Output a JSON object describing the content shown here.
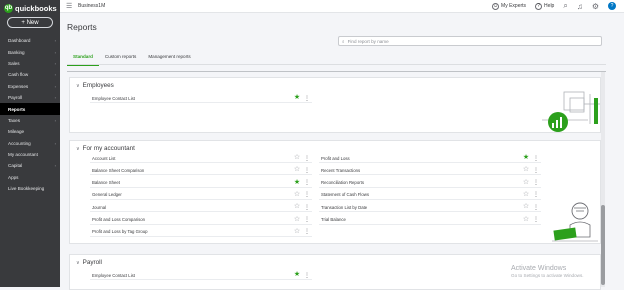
{
  "app": {
    "logo_text": "quickbooks",
    "new_label": "+ New"
  },
  "sidebar": {
    "items": [
      {
        "label": "Dashboard",
        "chev": true
      },
      {
        "label": "Banking",
        "chev": true
      },
      {
        "label": "Sales",
        "chev": true
      },
      {
        "label": "Cash flow",
        "chev": true
      },
      {
        "label": "Expenses",
        "chev": true
      },
      {
        "label": "Payroll",
        "chev": true
      },
      {
        "label": "Reports",
        "chev": false,
        "active": true
      },
      {
        "label": "Taxes",
        "chev": true
      },
      {
        "label": "Mileage",
        "chev": false
      },
      {
        "label": "Accounting",
        "chev": true
      },
      {
        "label": "My accountant",
        "chev": false
      },
      {
        "label": "Capital",
        "chev": true
      },
      {
        "label": "Apps",
        "chev": false
      },
      {
        "label": "Live Bookkeeping",
        "chev": false
      }
    ]
  },
  "topbar": {
    "company": "Business1M",
    "my_experts": "My Experts",
    "help": "Help"
  },
  "page": {
    "title": "Reports",
    "search_placeholder": "Find report by name"
  },
  "tabs": [
    "Standard",
    "Custom reports",
    "Management reports"
  ],
  "sections": {
    "employees": {
      "title": "Employees",
      "reports": [
        {
          "name": "Employee Contact List",
          "fav": true
        }
      ]
    },
    "accountant": {
      "title": "For my accountant",
      "left": [
        {
          "name": "Account List",
          "fav": false
        },
        {
          "name": "Balance Sheet Comparison",
          "fav": false
        },
        {
          "name": "Balance Sheet",
          "fav": true
        },
        {
          "name": "General Ledger",
          "fav": false
        },
        {
          "name": "Journal",
          "fav": false
        },
        {
          "name": "Profit and Loss Comparison",
          "fav": false
        },
        {
          "name": "Profit and Loss by Tag Group",
          "fav": false
        }
      ],
      "right": [
        {
          "name": "Profit and Loss",
          "fav": true
        },
        {
          "name": "Recent Transactions",
          "fav": false
        },
        {
          "name": "Reconciliation Reports",
          "fav": false
        },
        {
          "name": "Statement of Cash Flows",
          "fav": false
        },
        {
          "name": "Transaction List by Date",
          "fav": false
        },
        {
          "name": "Trial Balance",
          "fav": false
        }
      ]
    },
    "payroll": {
      "title": "Payroll",
      "reports": [
        {
          "name": "Employee Contact List",
          "fav": true
        }
      ]
    }
  },
  "watermark": {
    "line1": "Activate Windows",
    "line2": "Go to Settings to activate Windows."
  },
  "icons": {
    "star": "star-icon",
    "kebab": "kebab-icon",
    "search": "search-icon"
  },
  "colors": {
    "accent": "#2ca01c",
    "sidebar": "#393a3d"
  }
}
